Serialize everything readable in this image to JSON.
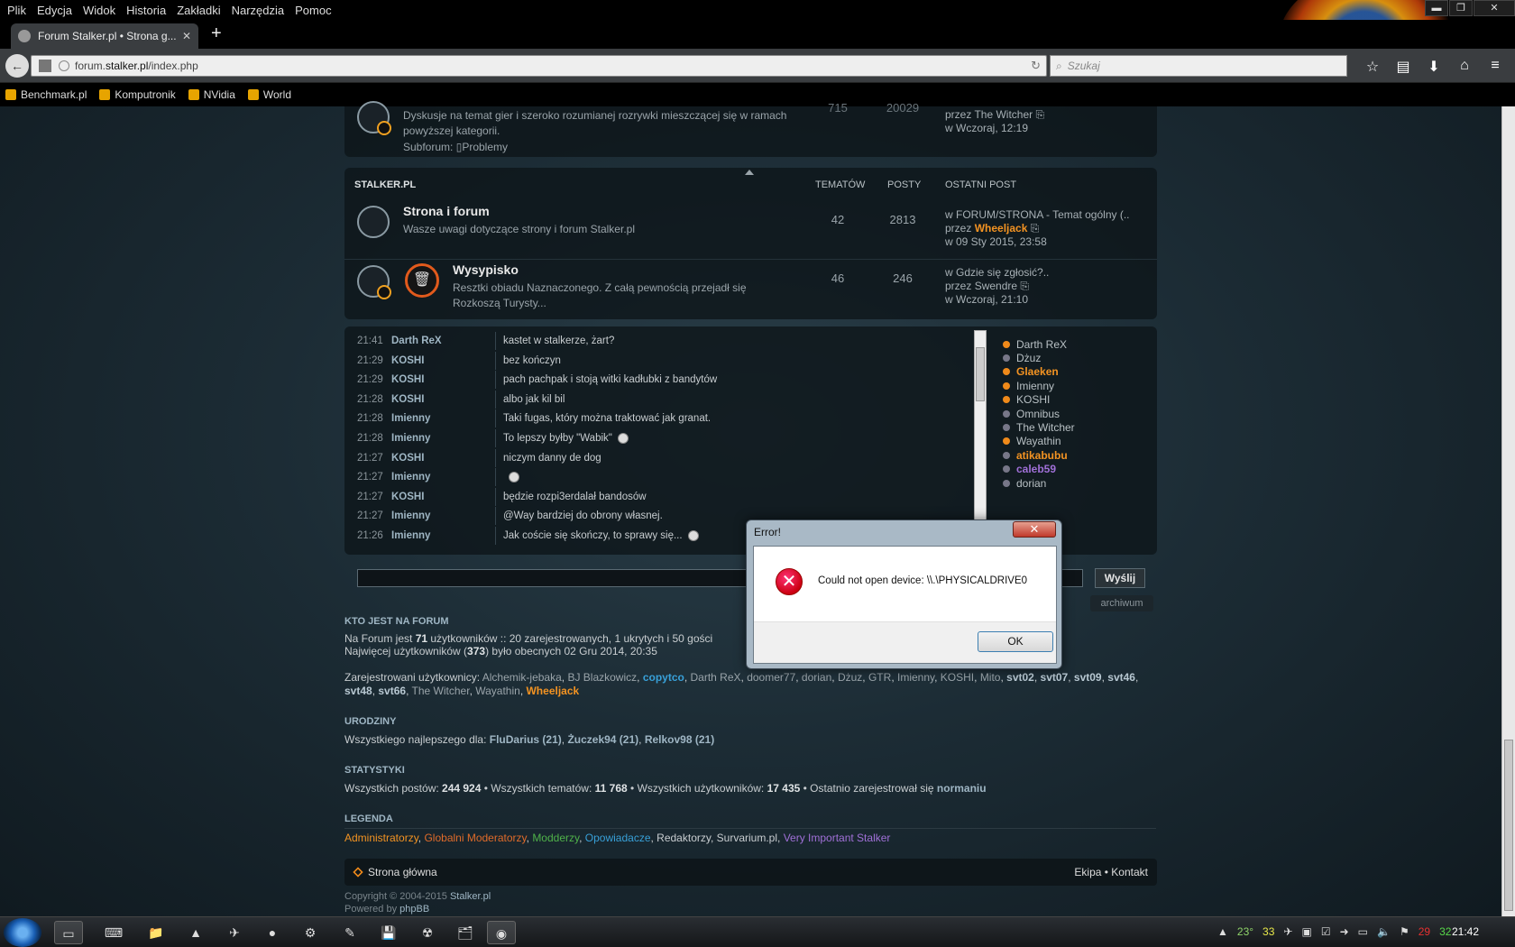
{
  "browser": {
    "menu": [
      "Plik",
      "Edycja",
      "Widok",
      "Historia",
      "Zakładki",
      "Narzędzia",
      "Pomoc"
    ],
    "tab_title": "Forum Stalker.pl • Strona g...",
    "url_prefix": "forum.",
    "url_domain": "stalker.pl",
    "url_path": "/index.php",
    "search_placeholder": "Szukaj",
    "bookmarks": [
      "Benchmark.pl",
      "Komputronik",
      "NVidia",
      "World"
    ],
    "win_min": "▬",
    "win_max": "❐",
    "win_close": "✕"
  },
  "top_forum": {
    "desc": "Dyskusje na temat gier i szeroko rozumianej rozrywki mieszczącej się w ramach powyższej kategorii.",
    "subforum_label": "Subforum:",
    "subforum": "Problemy",
    "topics": "715",
    "posts": "20029",
    "last_by": "przez The Witcher",
    "last_time": "w Wczoraj, 12:19"
  },
  "category": {
    "name": "STALKER.PL",
    "col_topics": "TEMATÓW",
    "col_posts": "POSTY",
    "col_last": "OSTATNI POST",
    "forums": [
      {
        "title": "Strona i forum",
        "desc": "Wasze uwagi dotyczące strony i forum Stalker.pl",
        "topics": "42",
        "posts": "2813",
        "last_in": "w FORUM/STRONA - Temat ogólny (..",
        "last_by_prefix": "przez ",
        "last_by": "Wheeljack",
        "last_time": "w 09 Sty 2015, 23:58"
      },
      {
        "title": "Wysypisko",
        "desc": "Resztki obiadu Naznaczonego. Z całą pewnością przejadł się Rozkoszą Turysty...",
        "topics": "46",
        "posts": "246",
        "last_in": "w Gdzie się zgłosić?..",
        "last_by_prefix": "przez ",
        "last_by": "Swendre",
        "last_time": "w Wczoraj, 21:10"
      }
    ]
  },
  "shoutbox": {
    "messages": [
      {
        "time": "21:41",
        "user": "Darth ReX",
        "msg": "kastet w stalkerze, żart?"
      },
      {
        "time": "21:29",
        "user": "KOSHI",
        "msg": "bez kończyn"
      },
      {
        "time": "21:29",
        "user": "KOSHI",
        "msg": "pach pachpak i stoją witki kadłubki z bandytów"
      },
      {
        "time": "21:28",
        "user": "KOSHI",
        "msg": "albo jak kil bil"
      },
      {
        "time": "21:28",
        "user": "Imienny",
        "msg": "Taki fugas, który można traktować jak granat."
      },
      {
        "time": "21:28",
        "user": "Imienny",
        "msg": "To lepszy byłby \"Wabik\""
      },
      {
        "time": "21:27",
        "user": "KOSHI",
        "msg": "niczym danny de dog"
      },
      {
        "time": "21:27",
        "user": "Imienny",
        "msg": ""
      },
      {
        "time": "21:27",
        "user": "KOSHI",
        "msg": "będzie rozpi3erdalał bandosów"
      },
      {
        "time": "21:27",
        "user": "Imienny",
        "msg": "@Way bardziej do obrony własnej."
      },
      {
        "time": "21:26",
        "user": "Imienny",
        "msg": "Jak coście się skończy, to sprawy się..."
      }
    ],
    "online": [
      {
        "name": "Darth ReX",
        "on": true,
        "style": ""
      },
      {
        "name": "Dżuz",
        "on": false,
        "style": ""
      },
      {
        "name": "Glaeken",
        "on": true,
        "style": "orange"
      },
      {
        "name": "Imienny",
        "on": true,
        "style": ""
      },
      {
        "name": "KOSHI",
        "on": true,
        "style": ""
      },
      {
        "name": "Omnibus",
        "on": false,
        "style": ""
      },
      {
        "name": "The Witcher",
        "on": false,
        "style": ""
      },
      {
        "name": "Wayathin",
        "on": true,
        "style": ""
      },
      {
        "name": "atikabubu",
        "on": false,
        "style": "orange"
      },
      {
        "name": "caleb59",
        "on": false,
        "style": "purple"
      },
      {
        "name": "dorian",
        "on": false,
        "style": ""
      }
    ],
    "send": "Wyślij",
    "archive": "archiwum"
  },
  "who": {
    "title": "KTO JEST NA FORUM",
    "line1_a": "Na Forum jest ",
    "line1_b": "71",
    "line1_c": " użytkowników :: 20 zarejestrowanych, 1 ukrytych i 50 gości",
    "line2_a": "Najwięcej użytkowników (",
    "line2_b": "373",
    "line2_c": ") było obecnych 02 Gru 2014, 20:35",
    "reg_label": "Zarejestrowani użytkownicy: ",
    "reg_users": [
      {
        "n": "Alchemik-jebaka",
        "s": ""
      },
      {
        "n": "BJ Blazkowicz",
        "s": ""
      },
      {
        "n": "copytco",
        "s": "blue"
      },
      {
        "n": "Darth ReX",
        "s": ""
      },
      {
        "n": "doomer77",
        "s": ""
      },
      {
        "n": "dorian",
        "s": ""
      },
      {
        "n": "Dżuz",
        "s": ""
      },
      {
        "n": "GTR",
        "s": ""
      },
      {
        "n": "Imienny",
        "s": ""
      },
      {
        "n": "KOSHI",
        "s": ""
      },
      {
        "n": "Mito",
        "s": ""
      },
      {
        "n": "svt02",
        "s": "bold"
      },
      {
        "n": "svt07",
        "s": "bold"
      },
      {
        "n": "svt09",
        "s": "bold"
      },
      {
        "n": "svt46",
        "s": "bold"
      },
      {
        "n": "svt48",
        "s": "bold"
      },
      {
        "n": "svt66",
        "s": "bold"
      },
      {
        "n": "The Witcher",
        "s": ""
      },
      {
        "n": "Wayathin",
        "s": ""
      },
      {
        "n": "Wheeljack",
        "s": "orange"
      }
    ]
  },
  "birthdays": {
    "title": "URODZINY",
    "label": "Wszystkiego najlepszego dla: ",
    "users": [
      "FluDarius (21)",
      "Żuczek94 (21)",
      "Relkov98 (21)"
    ]
  },
  "stats": {
    "title": "STATYSTYKI",
    "posts_label": "Wszystkich postów: ",
    "posts": "244 924",
    "topics_label": " • Wszystkich tematów: ",
    "topics": "11 768",
    "users_label": " • Wszystkich użytkowników: ",
    "users": "17 435",
    "newest_label": " • Ostatnio zarejestrował się ",
    "newest": "normaniu"
  },
  "legend": {
    "title": "LEGENDA",
    "items": [
      {
        "n": "Administratorzy",
        "c": "#f39322"
      },
      {
        "n": "Globalni Moderatorzy",
        "c": "#e06b2a"
      },
      {
        "n": "Modderzy",
        "c": "#4fb24a"
      },
      {
        "n": "Opowiadacze",
        "c": "#38a0d8"
      },
      {
        "n": "Redaktorzy",
        "c": "#c8cdd0"
      },
      {
        "n": "Survarium.pl",
        "c": "#c8cdd0"
      },
      {
        "n": "Very Important Stalker",
        "c": "#a070d8"
      }
    ]
  },
  "footer": {
    "home": "Strona główna",
    "links": "Ekipa • Kontakt",
    "copyright_a": "Copyright © 2004-2015 ",
    "copyright_b": "Stalker.pl",
    "powered_a": "Powered by ",
    "powered_b": "phpBB"
  },
  "dialog": {
    "title": "Error!",
    "message": "Could not open device: \\\\.\\PHYSICALDRIVE0",
    "ok": "OK",
    "close": "✕",
    "icon": "✕"
  },
  "taskbar": {
    "icons": [
      "explorer-icon",
      "keyboard-icon",
      "folder-icon",
      "vlc-icon",
      "plane-icon",
      "coin-icon",
      "steam-icon",
      "tool-icon",
      "floppy-icon",
      "radiation-icon",
      "files-icon",
      "firefox-icon"
    ],
    "tray": {
      "t1": "23°",
      "t2": "33",
      "t3": "29",
      "t4": "32"
    },
    "clock": "21:42"
  }
}
